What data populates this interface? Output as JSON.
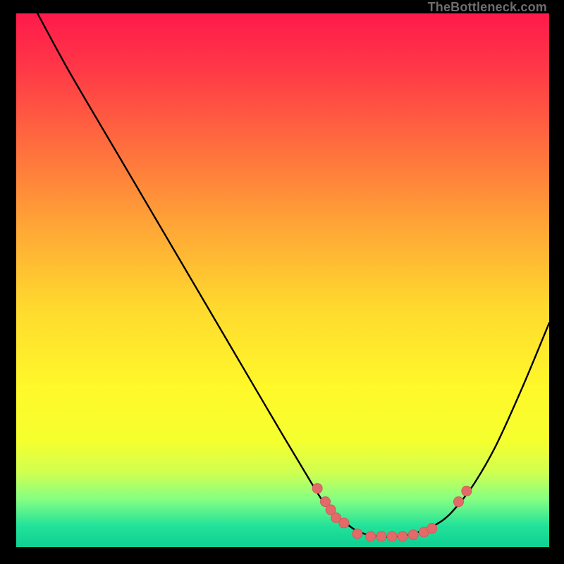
{
  "watermark": "TheBottleneck.com",
  "colors": {
    "background": "#000000",
    "gradient_stops": [
      {
        "offset": 0.0,
        "color": "#ff1a4b"
      },
      {
        "offset": 0.1,
        "color": "#ff3747"
      },
      {
        "offset": 0.25,
        "color": "#ff6e3e"
      },
      {
        "offset": 0.4,
        "color": "#ffa636"
      },
      {
        "offset": 0.55,
        "color": "#ffd92e"
      },
      {
        "offset": 0.7,
        "color": "#fff82a"
      },
      {
        "offset": 0.8,
        "color": "#f6ff2e"
      },
      {
        "offset": 0.86,
        "color": "#d0ff50"
      },
      {
        "offset": 0.91,
        "color": "#86ff82"
      },
      {
        "offset": 0.96,
        "color": "#22e29a"
      },
      {
        "offset": 1.0,
        "color": "#0fcf93"
      }
    ],
    "curve": "#000000",
    "marker_fill": "#e46a6a",
    "marker_stroke": "#cf5a5a"
  },
  "chart_data": {
    "type": "line",
    "title": "",
    "xlabel": "",
    "ylabel": "",
    "xlim": [
      0,
      100
    ],
    "ylim": [
      0,
      100
    ],
    "grid": false,
    "legend": false,
    "series": [
      {
        "name": "bottleneck-curve",
        "x": [
          4,
          10,
          20,
          30,
          40,
          50,
          56,
          58,
          60,
          64,
          68,
          72,
          76,
          80,
          83,
          86,
          90,
          95,
          100
        ],
        "y": [
          100,
          89,
          72,
          55,
          38,
          21,
          11,
          8,
          6,
          3,
          2,
          2,
          3,
          5,
          8,
          12,
          19,
          30,
          42
        ]
      }
    ],
    "markers": {
      "name": "highlight-points",
      "x": [
        56.5,
        58.0,
        59.0,
        60.0,
        61.5,
        64.0,
        66.5,
        68.5,
        70.5,
        72.5,
        74.5,
        76.5,
        78.0,
        83.0,
        84.5
      ],
      "y": [
        11.0,
        8.5,
        7.0,
        5.5,
        4.5,
        2.5,
        2.0,
        2.0,
        2.0,
        2.0,
        2.3,
        2.8,
        3.5,
        8.5,
        10.5
      ]
    }
  }
}
